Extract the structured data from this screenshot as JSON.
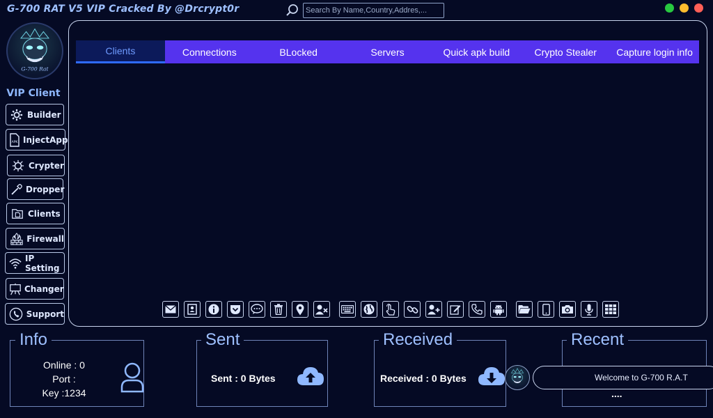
{
  "window": {
    "title": "G-700 RAT V5 VIP Cracked By @Drcrypt0r",
    "controls": [
      {
        "name": "minimize",
        "color": "#28c840"
      },
      {
        "name": "maximize",
        "color": "#febc2e"
      },
      {
        "name": "close",
        "color": "#ff5f57"
      }
    ]
  },
  "search": {
    "placeholder": "Search By Name,Country,Addres,..."
  },
  "sidebar": {
    "logo_text": "G-700 Rat",
    "heading": "VIP Client",
    "items": [
      {
        "label": "Builder",
        "icon": "gear-icon"
      },
      {
        "label": "InjectApp",
        "icon": "apk-file-icon"
      },
      {
        "label": "Crypter",
        "icon": "virus-icon"
      },
      {
        "label": "Dropper",
        "icon": "pipette-icon"
      },
      {
        "label": "Clients",
        "icon": "folder-file-icon"
      },
      {
        "label": "Firewall",
        "icon": "firewall-icon"
      },
      {
        "label": "IP Setting",
        "icon": "wifi-icon"
      },
      {
        "label": "Changer",
        "icon": "easel-icon"
      },
      {
        "label": "Support",
        "icon": "support-icon"
      }
    ]
  },
  "tabs": [
    "Clients",
    "Connections",
    "BLocked",
    "Servers",
    "Quick apk build",
    "Crypto Stealer",
    "Capture login info"
  ],
  "active_tab": "Clients",
  "toolbar": [
    "mail-icon",
    "contacts-icon",
    "info-icon",
    "pocket-icon",
    "chat-icon",
    "trash-icon",
    "location-icon",
    "user-remove-icon",
    "keyboard-icon",
    "globe-icon",
    "touch-icon",
    "link-icon",
    "user-add-icon",
    "edit-icon",
    "phone-icon",
    "android-icon",
    "folder-icon",
    "mobile-icon",
    "camera-icon",
    "microphone-icon",
    "apps-grid-icon"
  ],
  "info": {
    "title": "Info",
    "online": "Online : 0",
    "port": "Port :",
    "key": "Key :1234"
  },
  "sent": {
    "title": "Sent",
    "text": "Sent : 0 Bytes"
  },
  "received": {
    "title": "Received",
    "text": "Received : 0 Bytes"
  },
  "recent": {
    "title": "Recent",
    "dots": "...."
  },
  "toast": {
    "text": "Welcome to  G-700 R.A.T"
  },
  "colors": {
    "accent": "#5533ee",
    "active_tab_text": "#6f9bff",
    "background": "#050a24",
    "title": "#9ec0ff"
  }
}
